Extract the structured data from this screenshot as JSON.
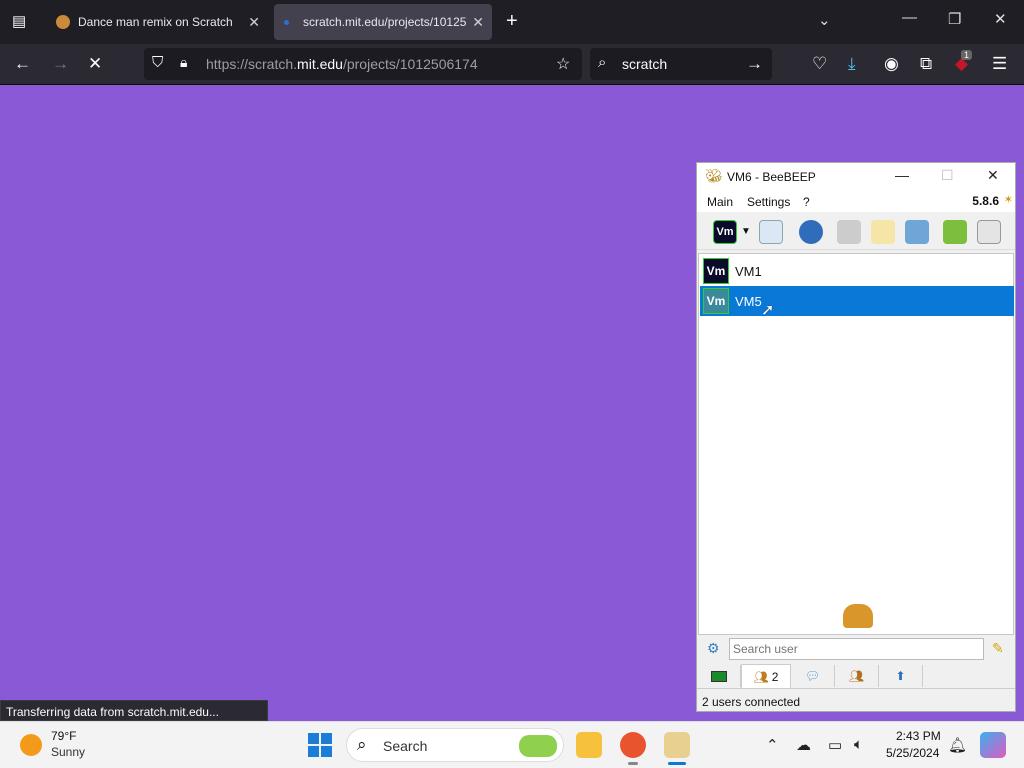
{
  "browser": {
    "tabs": [
      {
        "title": "Dance man remix on Scratch",
        "active": false
      },
      {
        "title": "scratch.mit.edu/projects/10125",
        "active": true
      }
    ],
    "url_prefix": "https://scratch.",
    "url_domain": "mit.edu",
    "url_path": "/projects/1012506174",
    "search_query": "scratch",
    "extension_badge": "1",
    "status_text": "Transferring data from scratch.mit.edu...",
    "page_background": "#8a5ad6"
  },
  "beebeep": {
    "title": "VM6 - BeeBEEP",
    "menu": [
      "Main",
      "Settings",
      "?"
    ],
    "version": "5.8.6",
    "avatar_label": "Vm",
    "users": [
      {
        "name": "VM1",
        "selected": false
      },
      {
        "name": "VM5",
        "selected": true
      }
    ],
    "search_placeholder": "Search user",
    "users_tab_count": "2",
    "status": "2 users connected",
    "selection_color": "#0a78d7"
  },
  "taskbar": {
    "temperature": "79°F",
    "condition": "Sunny",
    "search_label": "Search",
    "time": "2:43 PM",
    "date": "5/25/2024"
  }
}
